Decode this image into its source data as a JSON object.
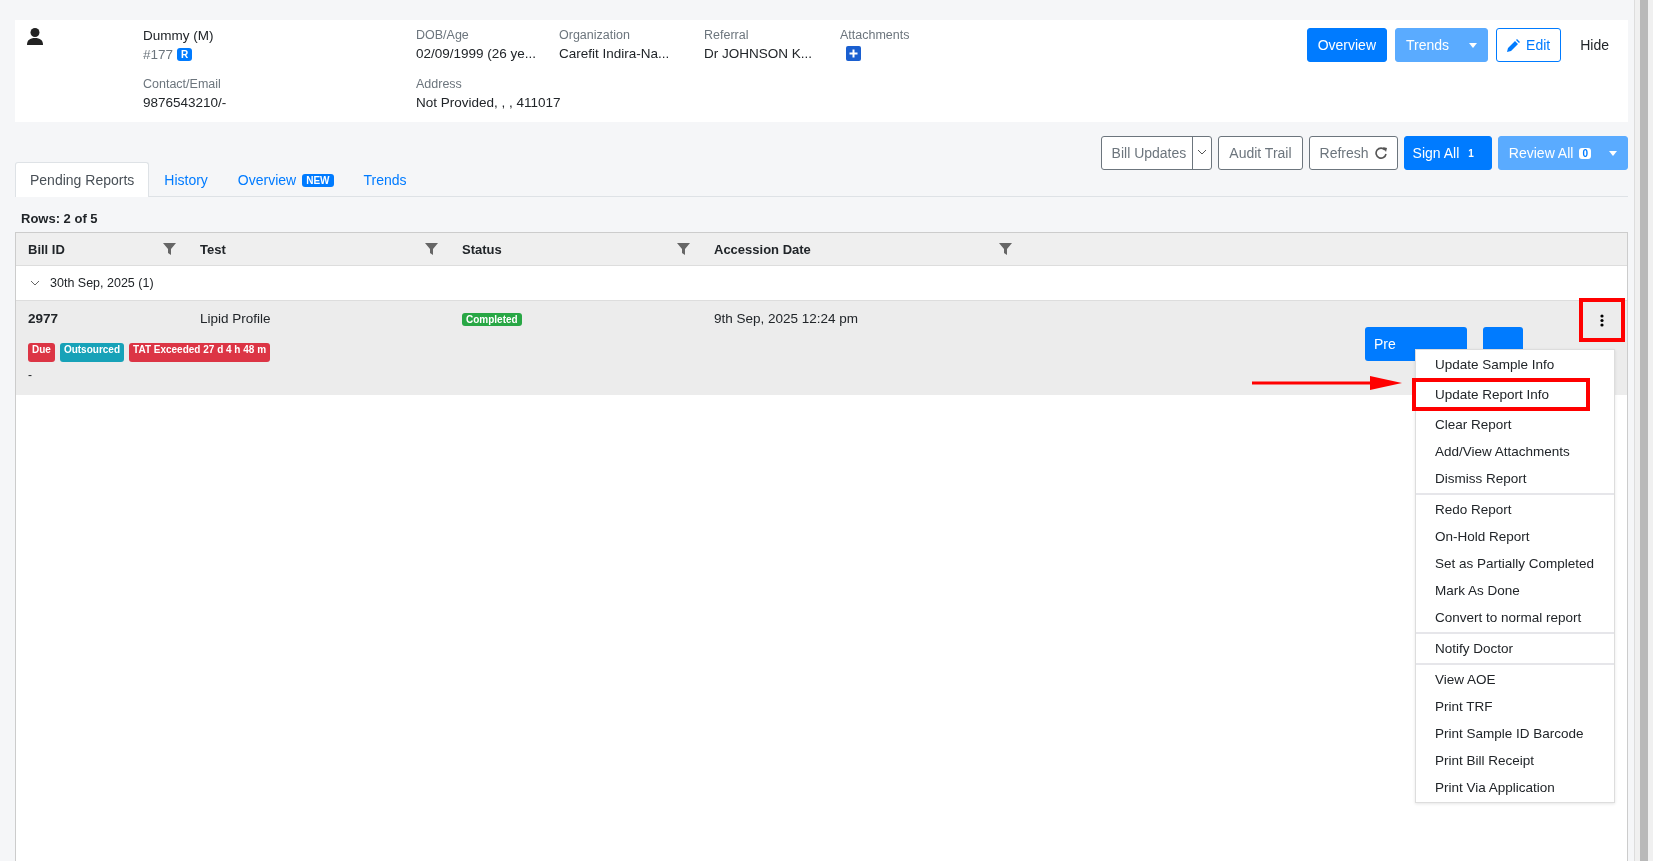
{
  "patient": {
    "name": "Dummy (M)",
    "id": "#177",
    "id_badge": "R",
    "contact_label": "Contact/Email",
    "contact": "9876543210/-",
    "fields": [
      {
        "label": "DOB/Age",
        "value": "02/09/1999 (26 ye..."
      },
      {
        "label": "Organization",
        "value": "Carefit Indira-Na..."
      },
      {
        "label": "Referral",
        "value": "Dr JOHNSON K..."
      }
    ],
    "attachments_label": "Attachments",
    "address_label": "Address",
    "address": "Not Provided, , , 411017"
  },
  "header_buttons": [
    {
      "label": "Overview",
      "kind": "primary"
    },
    {
      "label": "Trends",
      "kind": "split"
    },
    {
      "label": "Edit",
      "kind": "outline"
    },
    {
      "label": "Hide",
      "kind": "plain"
    }
  ],
  "toolbar": [
    {
      "label": "Bill Updates",
      "kind": "dropdown"
    },
    {
      "label": "Audit Trail",
      "kind": "outline"
    },
    {
      "label": "Refresh",
      "kind": "refresh"
    },
    {
      "label": "Sign All",
      "kind": "primary",
      "count": "1"
    },
    {
      "label": "Review All",
      "kind": "split",
      "count": "0"
    }
  ],
  "tabs": [
    {
      "label": "Pending Reports",
      "selected": true
    },
    {
      "label": "History",
      "selected": false
    },
    {
      "label": "Overview",
      "selected": false,
      "badge": "NEW"
    },
    {
      "label": "Trends",
      "selected": false
    }
  ],
  "rows_count": "Rows: 2 of 5",
  "table": {
    "columns": [
      "Bill ID",
      "Test",
      "Status",
      "Accession Date"
    ],
    "groups": [
      {
        "label": "30th Sep, 2025 (1)",
        "expanded": true,
        "rows": [
          {
            "bill_id": "2977",
            "test": "Lipid Profile",
            "status": "Completed",
            "accession_date": "9th Sep, 2025 12:24 pm",
            "note": "-",
            "tags": [
              {
                "label": "Due",
                "color": "#dc3545"
              },
              {
                "label": "Outsourced",
                "color": "#17a2b8"
              },
              {
                "label": "TAT Exceeded 27 d 4 h 48 m",
                "color": "#dc3545"
              }
            ],
            "actions": [
              {
                "label": "Pre"
              },
              {
                "kind": "covered"
              }
            ],
            "more_highlighted": true
          }
        ]
      }
    ]
  },
  "menu": {
    "groups": [
      {
        "items": [
          {
            "label": "Update Sample Info",
            "highlighted": false
          },
          {
            "label": "Update Report Info",
            "highlighted": true
          },
          {
            "label": "Clear Report",
            "highlighted": false
          },
          {
            "label": "Add/View Attachments",
            "highlighted": false
          },
          {
            "label": "Dismiss Report",
            "highlighted": false
          }
        ]
      },
      {
        "items": [
          {
            "label": "Redo Report",
            "highlighted": false
          },
          {
            "label": "On-Hold Report",
            "highlighted": false
          },
          {
            "label": "Set as Partially Completed",
            "highlighted": false
          },
          {
            "label": "Mark As Done",
            "highlighted": false
          },
          {
            "label": "Convert to normal report",
            "highlighted": false
          }
        ]
      },
      {
        "items": [
          {
            "label": "Notify Doctor",
            "highlighted": false
          }
        ]
      },
      {
        "items": [
          {
            "label": "View AOE",
            "highlighted": false
          },
          {
            "label": "Print TRF",
            "highlighted": false
          },
          {
            "label": "Print Sample ID Barcode",
            "highlighted": false
          },
          {
            "label": "Print Bill Receipt",
            "highlighted": false
          },
          {
            "label": "Print Via Application",
            "highlighted": false
          }
        ]
      }
    ]
  }
}
